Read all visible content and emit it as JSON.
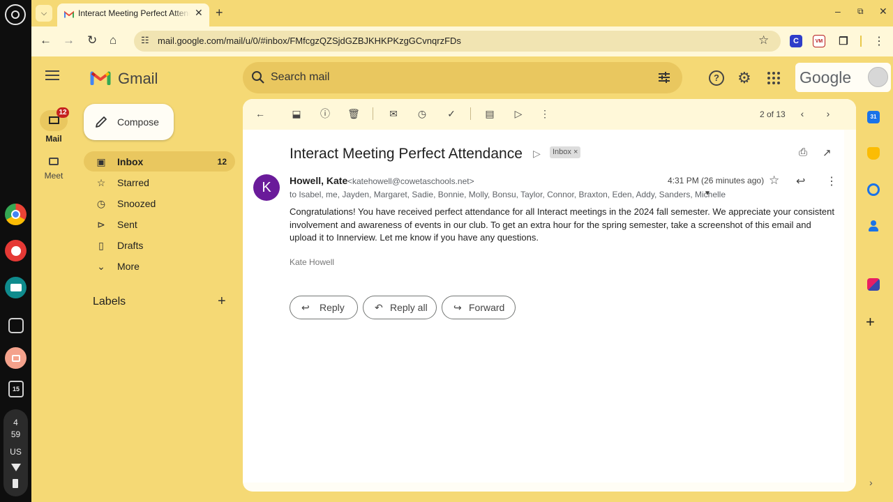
{
  "os": {
    "tray_time_hour": "4",
    "tray_time_min": "59",
    "tray_locale": "US",
    "calendar_day": "15"
  },
  "browser": {
    "tab_title": "Interact Meeting Perfect Attendance",
    "url": "mail.google.com/mail/u/0/#inbox/FMfcgzQZSjdGZBJKHKPKzgGCvnqrzFDs",
    "ext_c_label": "C",
    "ext_vm_label": "VM"
  },
  "gmail": {
    "wordmark": "Gmail",
    "search_placeholder": "Search mail",
    "google_word": "Google",
    "rail": {
      "mail_label": "Mail",
      "mail_badge": "12",
      "meet_label": "Meet"
    },
    "compose_label": "Compose",
    "nav": [
      {
        "label": "Inbox",
        "count": "12",
        "icon": "inbox-icon"
      },
      {
        "label": "Starred",
        "count": "",
        "icon": "star-icon"
      },
      {
        "label": "Snoozed",
        "count": "",
        "icon": "clock-icon"
      },
      {
        "label": "Sent",
        "count": "",
        "icon": "send-icon"
      },
      {
        "label": "Drafts",
        "count": "",
        "icon": "draft-icon"
      },
      {
        "label": "More",
        "count": "",
        "icon": "chevron-down-icon"
      }
    ],
    "labels_title": "Labels",
    "pager_text": "2 of 13",
    "message": {
      "subject": "Interact Meeting Perfect Attendance",
      "label_chip": "Inbox",
      "sender_initial": "K",
      "sender_name": "Howell, Kate",
      "sender_email": "<katehowell@cowetaschools.net>",
      "time": "4:31 PM (26 minutes ago)",
      "recipients": "to Isabel, me, Jayden, Margaret, Sadie, Bonnie, Molly, Bonsu, Taylor, Connor, Braxton, Eden, Addy, Sanders, Michelle",
      "body": "Congratulations! You have received perfect attendance for all Interact meetings in the 2024 fall semester. We appreciate your consistent involvement and awareness of events in our club. To get an extra hour for the spring semester, take a screenshot of this email and upload it to Innerview. Let me know if you have any questions.",
      "signature": "Kate Howell"
    },
    "actions": {
      "reply": "Reply",
      "reply_all": "Reply all",
      "forward": "Forward"
    },
    "side_calendar_day": "31"
  },
  "colors": {
    "theme_yellow": "#f5d975",
    "avatar_purple": "#6a1b9a",
    "badge_red": "#c5221f"
  }
}
